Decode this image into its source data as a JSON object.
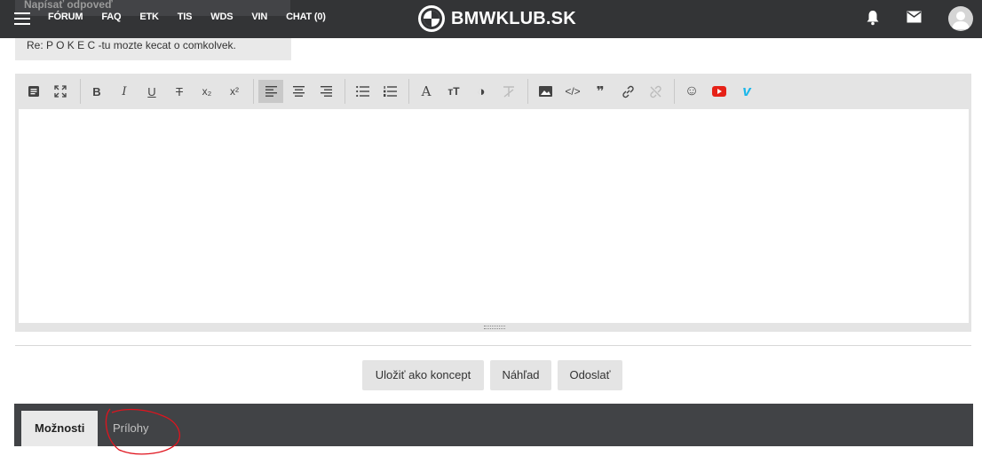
{
  "nav": {
    "items": [
      "FÓRUM",
      "FAQ",
      "ETK",
      "TIS",
      "WDS",
      "VIN",
      "CHAT (0)"
    ],
    "brand": "BMWKLUB.SK",
    "hidden_heading": "Napísať odpoveď"
  },
  "subject": "Re: P O K E C -tu mozte kecat o comkolvek.",
  "toolbar": {
    "tools": [
      {
        "name": "source",
        "glyph": "▤"
      },
      {
        "name": "fullscreen",
        "glyph": "⤢"
      },
      {
        "name": "bold",
        "glyph": "B"
      },
      {
        "name": "italic",
        "glyph": "I"
      },
      {
        "name": "underline",
        "glyph": "U"
      },
      {
        "name": "strikethrough",
        "glyph": "T"
      },
      {
        "name": "subscript",
        "glyph": "x₂"
      },
      {
        "name": "superscript",
        "glyph": "x²"
      },
      {
        "name": "align-left",
        "glyph": "≡"
      },
      {
        "name": "align-center",
        "glyph": "≡"
      },
      {
        "name": "align-right",
        "glyph": "≡"
      },
      {
        "name": "bullet-list",
        "glyph": "☰"
      },
      {
        "name": "numbered-list",
        "glyph": "☰"
      },
      {
        "name": "font",
        "glyph": "A"
      },
      {
        "name": "font-size",
        "glyph": "тT"
      },
      {
        "name": "color",
        "glyph": "◑"
      },
      {
        "name": "clear-format",
        "glyph": "✕"
      },
      {
        "name": "image",
        "glyph": "▬"
      },
      {
        "name": "code",
        "glyph": "</>"
      },
      {
        "name": "quote",
        "glyph": "❞"
      },
      {
        "name": "link",
        "glyph": "🔗"
      },
      {
        "name": "unlink",
        "glyph": "⛓"
      },
      {
        "name": "emoji",
        "glyph": "☺"
      },
      {
        "name": "youtube",
        "glyph": "▶"
      },
      {
        "name": "vimeo",
        "glyph": "v"
      }
    ]
  },
  "actions": {
    "save_draft": "Uložiť ako koncept",
    "preview": "Náhľad",
    "send": "Odoslať"
  },
  "tabs": {
    "options": "Možnosti",
    "attachments": "Prílohy"
  },
  "colors": {
    "nav_bg": "#333436",
    "tab_bar_bg": "#414346",
    "youtube": "#e62117",
    "vimeo": "#1ab7ea",
    "annotation": "#e0141e"
  }
}
